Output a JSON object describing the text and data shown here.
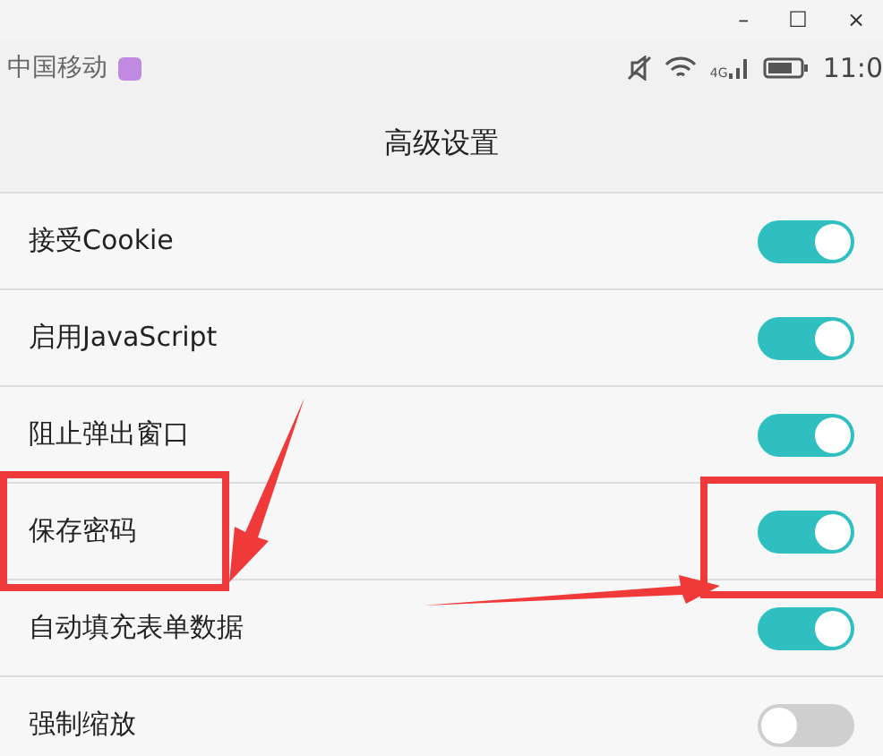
{
  "window": {
    "controls": [
      "–",
      "☐",
      "×"
    ]
  },
  "status_bar": {
    "carrier": "中国移动",
    "time": "11:0",
    "network": "4G"
  },
  "title": "高级设置",
  "settings": [
    {
      "label": "接受Cookie",
      "on": true
    },
    {
      "label": "启用JavaScript",
      "on": true
    },
    {
      "label": "阻止弹出窗口",
      "on": true
    },
    {
      "label": "保存密码",
      "on": true
    },
    {
      "label": "自动填充表单数据",
      "on": true
    },
    {
      "label": "强制缩放",
      "on": false
    }
  ]
}
